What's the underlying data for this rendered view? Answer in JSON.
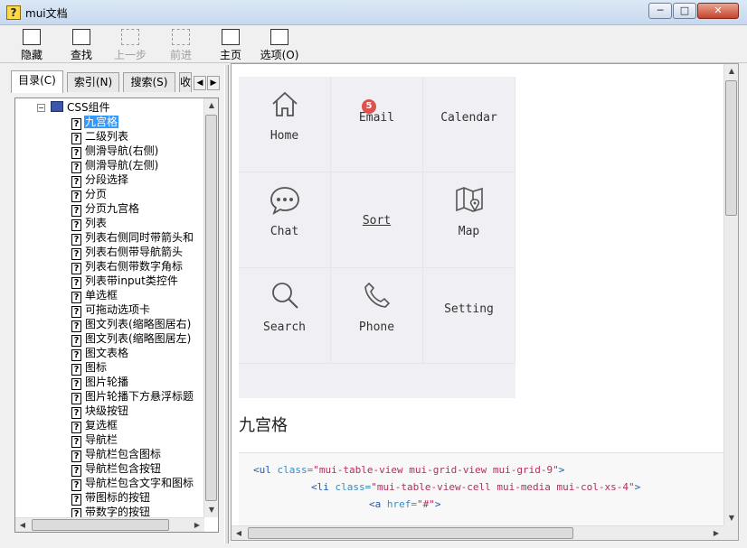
{
  "window": {
    "title": "mui文档",
    "minimize": "─",
    "maximize": "□",
    "close": "✕"
  },
  "toolbar": {
    "hide": "隐藏",
    "find": "查找",
    "back": "上一步",
    "forward": "前进",
    "home": "主页",
    "options": "选项(O)"
  },
  "tabs": [
    {
      "label": "目录(C)"
    },
    {
      "label": "索引(N)"
    },
    {
      "label": "搜索(S)"
    },
    {
      "label": "收"
    }
  ],
  "tree": {
    "root": "CSS组件",
    "items": [
      "九宫格",
      "二级列表",
      "侧滑导航(右侧)",
      "侧滑导航(左侧)",
      "分段选择",
      "分页",
      "分页九宫格",
      "列表",
      "列表右侧同时带箭头和",
      "列表右侧带导航箭头",
      "列表右侧带数字角标",
      "列表带input类控件",
      "单选框",
      "可拖动选项卡",
      "图文列表(缩略图居右)",
      "图文列表(缩略图居左)",
      "图文表格",
      "图标",
      "图片轮播",
      "图片轮播下方悬浮标题",
      "块级按钮",
      "复选框",
      "导航栏",
      "导航栏包含图标",
      "导航栏包含按钮",
      "导航栏包含文字和图标",
      "带图标的按钮",
      "带数字的按钮"
    ]
  },
  "grid": {
    "cells": [
      {
        "label": "Home",
        "icon": "home-icon"
      },
      {
        "label": "Email",
        "icon": "email-icon",
        "badge": "5"
      },
      {
        "label": "Calendar",
        "icon": "calendar-icon"
      },
      {
        "label": "Chat",
        "icon": "chat-icon"
      },
      {
        "label": "Sort",
        "icon": "sort-icon"
      },
      {
        "label": "Map",
        "icon": "map-icon"
      },
      {
        "label": "Search",
        "icon": "search-icon"
      },
      {
        "label": "Phone",
        "icon": "phone-icon"
      },
      {
        "label": "Setting",
        "icon": "setting-icon"
      }
    ]
  },
  "section": {
    "heading": "九宫格"
  },
  "code": {
    "line1": {
      "tag_open": "<ul ",
      "attr": "class=",
      "value": "\"mui-table-view mui-grid-view mui-grid-9\"",
      "tag_close": ">"
    },
    "line2": {
      "tag_open": "<li ",
      "attr": "class=",
      "value": "\"mui-table-view-cell mui-media mui-col-xs-4\"",
      "tag_close": ">"
    },
    "line3": {
      "tag_open": "<a ",
      "attr": "href=",
      "value": "\"#\"",
      "tag_close": ">"
    }
  },
  "colors": {
    "selection": "#3399ff",
    "badge": "#dd524d",
    "grid_bg": "#efeff4"
  }
}
